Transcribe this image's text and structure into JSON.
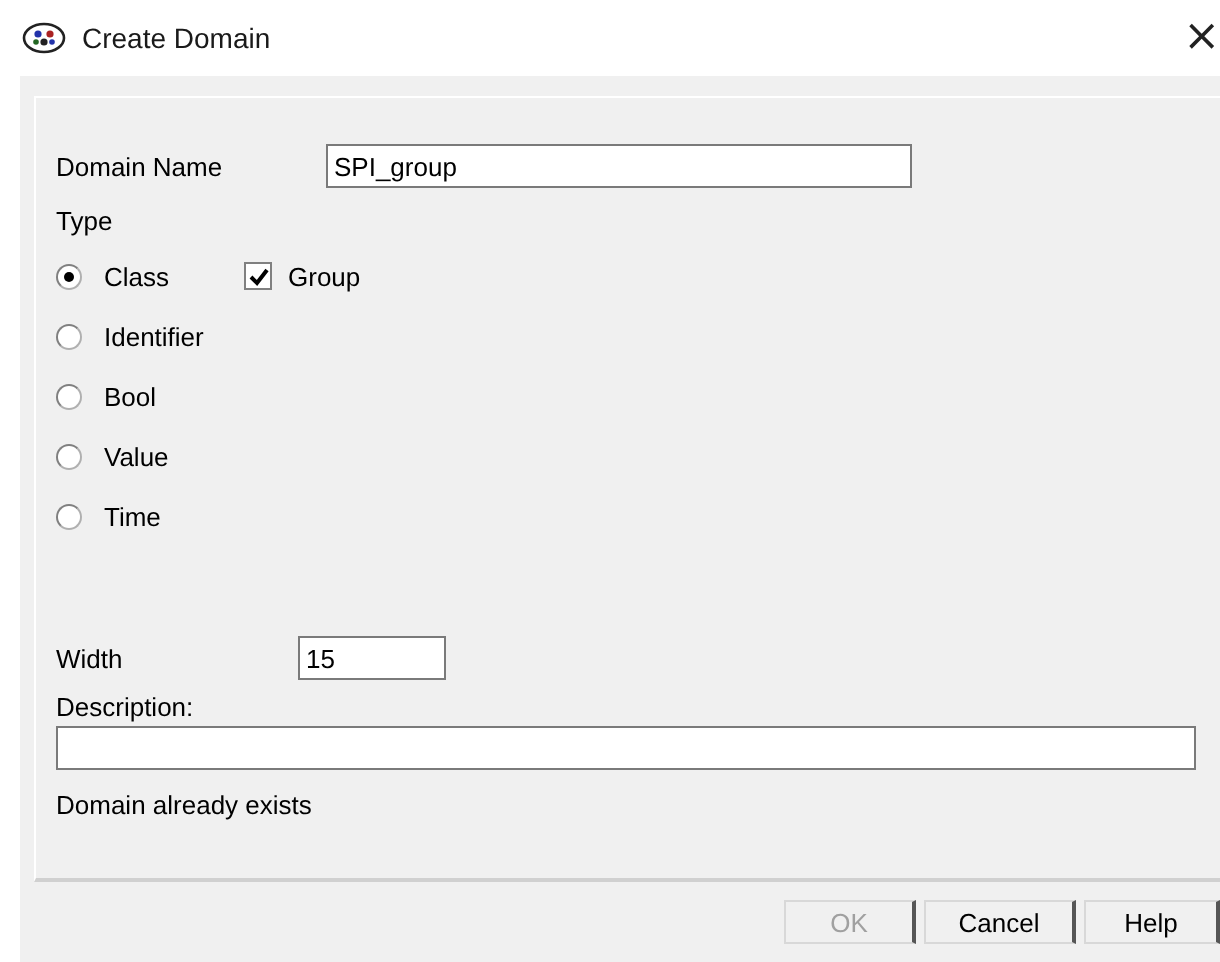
{
  "window": {
    "title": "Create Domain",
    "close": "×"
  },
  "domain_name": {
    "label": "Domain Name",
    "value": "SPI_group"
  },
  "type": {
    "label": "Type",
    "options": [
      {
        "label": "Class",
        "selected": true
      },
      {
        "label": "Identifier",
        "selected": false
      },
      {
        "label": "Bool",
        "selected": false
      },
      {
        "label": "Value",
        "selected": false
      },
      {
        "label": "Time",
        "selected": false
      }
    ]
  },
  "group": {
    "label": "Group",
    "checked": true
  },
  "width": {
    "label": "Width",
    "value": "15"
  },
  "description": {
    "label": "Description:"
  },
  "message": "Domain already exists",
  "buttons": [
    {
      "label": "OK",
      "disabled": true
    },
    {
      "label": "Cancel",
      "disabled": false
    },
    {
      "label": "Help",
      "disabled": false
    }
  ]
}
